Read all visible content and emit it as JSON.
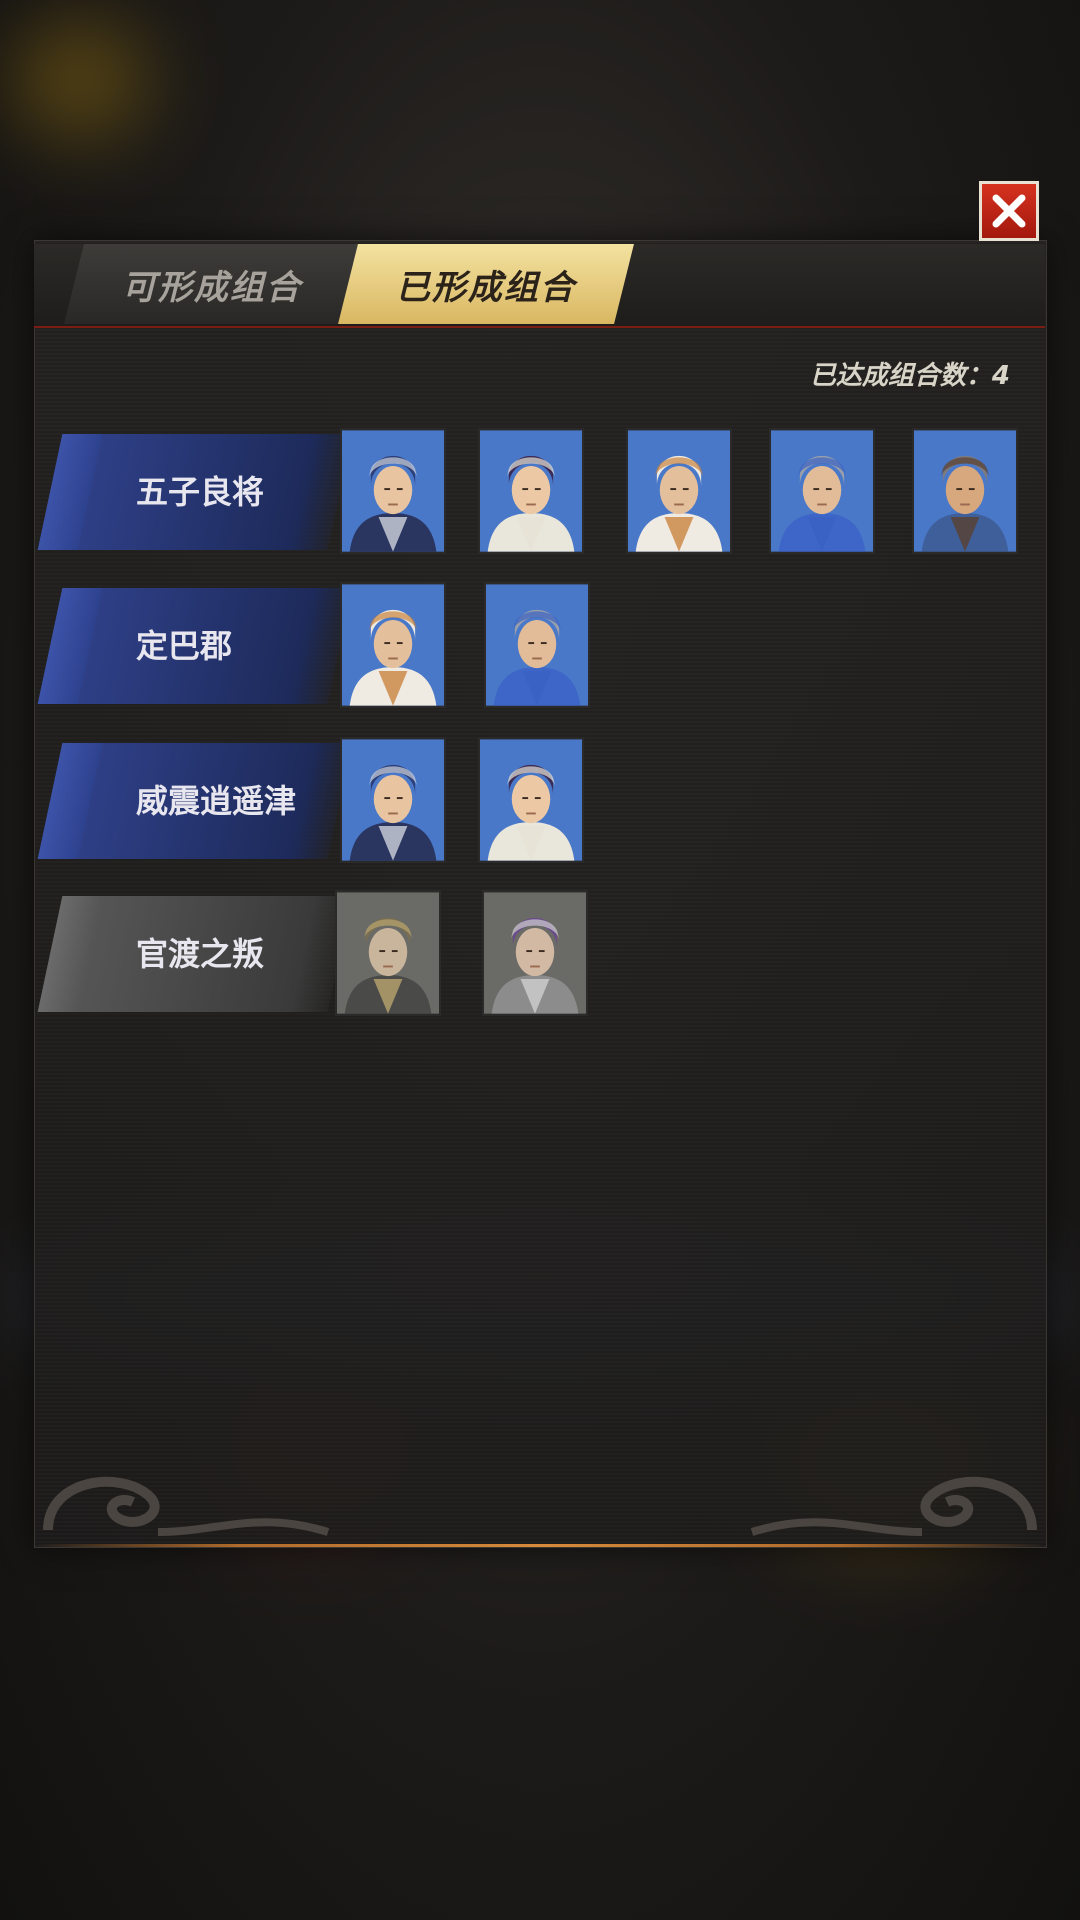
{
  "tabs": {
    "available_label": "可形成组合",
    "formed_label": "已形成组合",
    "active": "formed"
  },
  "summary": {
    "count_text": "已达成组合数：4"
  },
  "combos": [
    {
      "name": "五子良将",
      "style": "blue",
      "heroes": [
        "hero-blue-helm",
        "hero-purple-hair",
        "hero-white-hood",
        "hero-silver-scarf",
        "hero-bearded"
      ]
    },
    {
      "name": "定巴郡",
      "style": "blue",
      "heroes": [
        "hero-white-hood",
        "hero-silver-scarf"
      ]
    },
    {
      "name": "威震逍遥津",
      "style": "blue",
      "heroes": [
        "hero-blue-helm",
        "hero-purple-hair"
      ]
    },
    {
      "name": "官渡之叛",
      "style": "gray",
      "heroes": [
        "hero-gold-helm-gray",
        "hero-purple-spiky-gray"
      ]
    }
  ],
  "colors": {
    "accent_gold": "#e6c878",
    "close_red": "#c0261a",
    "banner_blue": "#2e3f86"
  }
}
